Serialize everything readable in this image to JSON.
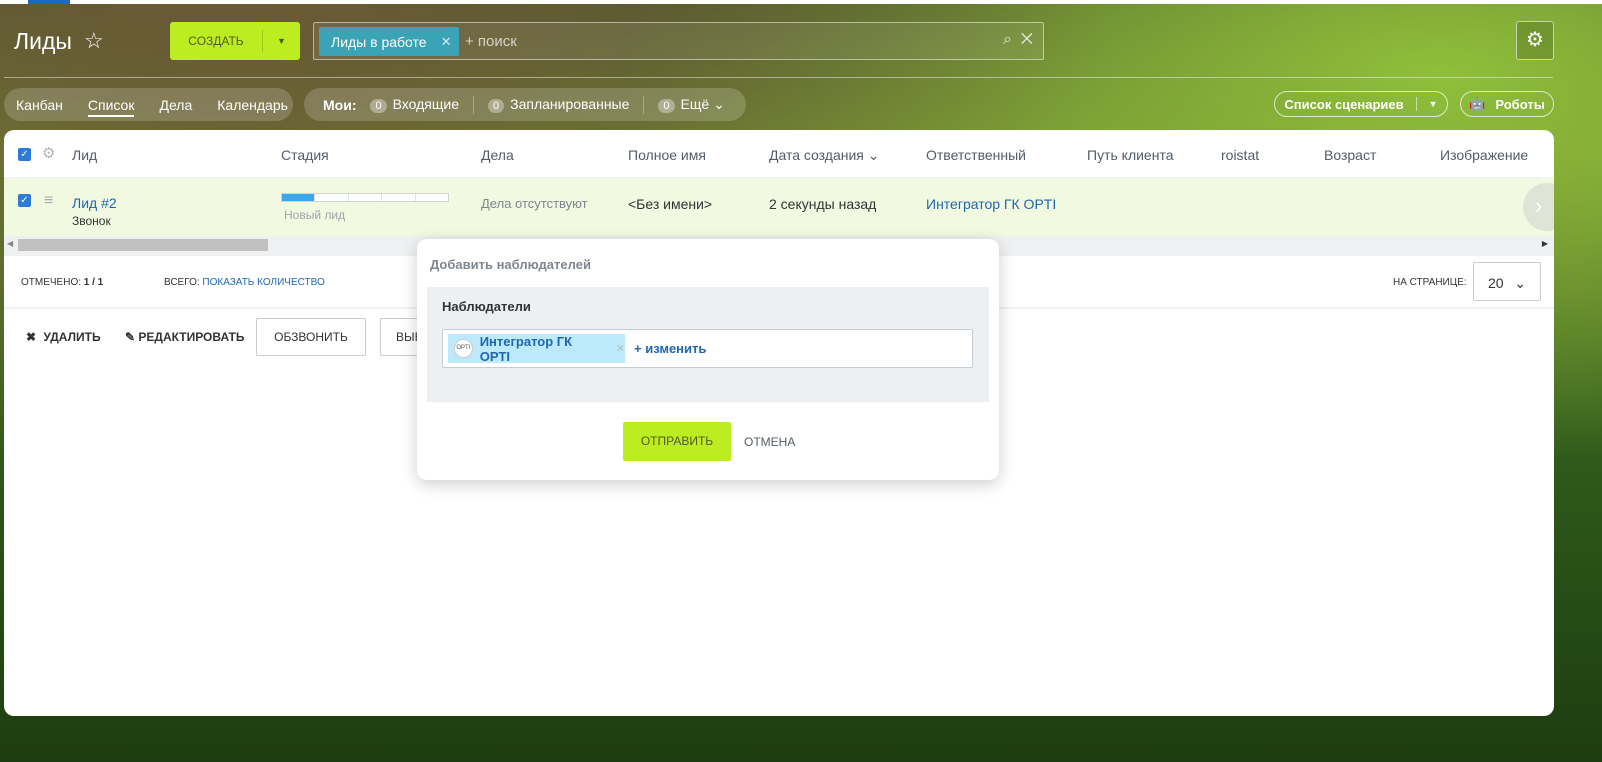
{
  "header": {
    "title": "Лиды",
    "create_label": "СОЗДАТЬ",
    "search_tag": "Лиды в работе",
    "search_placeholder": "+ поиск"
  },
  "nav": {
    "views": [
      "Канбан",
      "Список",
      "Дела",
      "Календарь"
    ],
    "active": "Список",
    "my_label": "Мои:",
    "counters": [
      {
        "count": "0",
        "label": "Входящие"
      },
      {
        "count": "0",
        "label": "Запланированные"
      },
      {
        "count": "0",
        "label": "Ещё"
      }
    ],
    "scenarios_label": "Список сценариев",
    "robots_label": "Роботы"
  },
  "table": {
    "columns": [
      "Лид",
      "Стадия",
      "Дела",
      "Полное имя",
      "Дата создания",
      "Ответственный",
      "Путь клиента",
      "roistat",
      "Возраст",
      "Изображение"
    ],
    "rows": [
      {
        "lead": "Лид #2",
        "source": "Звонок",
        "stage": "Новый лид",
        "stage_progress": "1/5",
        "activities": "Дела отсутствуют",
        "full_name": "<Без имени>",
        "created": "2 секунды назад",
        "responsible": "Интегратор ГК OPTI"
      }
    ]
  },
  "footer": {
    "checked_label": "ОТМЕЧЕНО:",
    "checked_value": "1 / 1",
    "total_label": "ВСЕГО:",
    "total_link": "ПОКАЗАТЬ КОЛИЧЕСТВО",
    "per_page_label": "НА СТРАНИЦЕ:",
    "per_page": "20"
  },
  "actions": {
    "delete": "УДАЛИТЬ",
    "edit": "РЕДАКТИРОВАТЬ",
    "call": "ОБЗВОНИТЬ",
    "more": "ВЫБ"
  },
  "popup": {
    "title": "Добавить наблюдателей",
    "section": "Наблюдатели",
    "observer": "Интегратор ГК OPTI",
    "change": "+ изменить",
    "send": "ОТПРАВИТЬ",
    "cancel": "ОТМЕНА"
  },
  "colors": {
    "accent": "#bbed21",
    "tag": "#3aa3b5",
    "link": "#2067b0",
    "row_selected": "#f1f9e1"
  }
}
